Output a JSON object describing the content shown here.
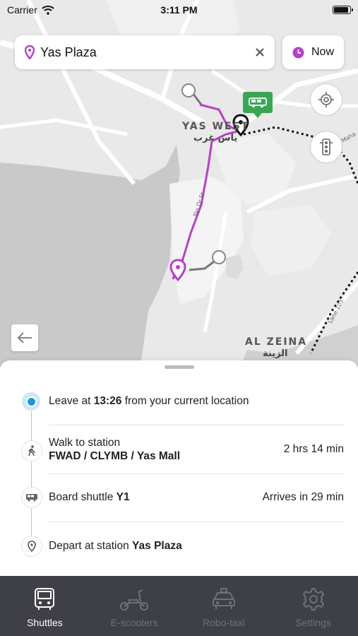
{
  "status_bar": {
    "carrier": "Carrier",
    "time": "3:11 PM"
  },
  "search": {
    "value": "Yas Plaza",
    "clear_icon": "close-icon"
  },
  "time_selector": {
    "label": "Now"
  },
  "map": {
    "district_1_en": "YAS WEST",
    "district_1_ar": "ياس غرب",
    "district_2_en": "AL ZEINA",
    "district_2_ar": "الزينة",
    "road_labels": [
      "Yas Dr St",
      "Lane 103",
      "Maha"
    ],
    "colors": {
      "route": "#b641c6",
      "walk": "#777777",
      "shuttle_marker": "#3aa655"
    }
  },
  "journey": {
    "steps": [
      {
        "prefix": "Leave at ",
        "bold": "13:26",
        "suffix": " from your current location"
      },
      {
        "line1": "Walk to station",
        "bold": "FWAD / CLYMB / Yas Mall",
        "right": "2 hrs 14 min"
      },
      {
        "prefix": "Board shuttle ",
        "bold": "Y1",
        "right": "Arrives in 29 min"
      },
      {
        "prefix": "Depart at station ",
        "bold": "Yas Plaza"
      }
    ]
  },
  "tabs": [
    {
      "label": "Shuttles",
      "active": true
    },
    {
      "label": "E-scooters",
      "active": false
    },
    {
      "label": "Robo-taxi",
      "active": false
    },
    {
      "label": "Settings",
      "active": false
    }
  ]
}
